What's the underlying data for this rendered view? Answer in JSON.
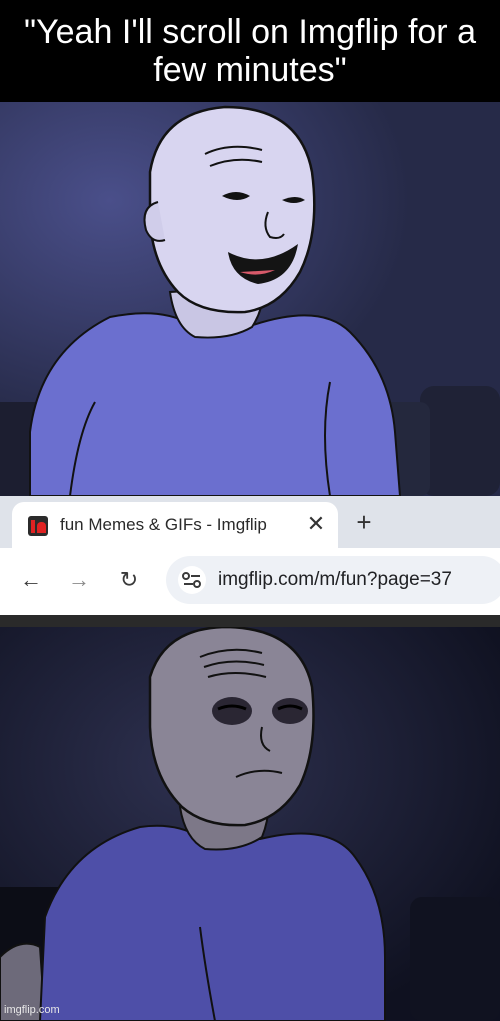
{
  "meme": {
    "caption": "\"Yeah I'll scroll on Imgflip for a few minutes\"",
    "watermark": "imgflip.com"
  },
  "browser": {
    "tab_title": "fun Memes & GIFs - Imgflip",
    "url": "imgflip.com/m/fun?page=37"
  },
  "icons": {
    "favicon": "imgflip-logo-icon",
    "tab_close": "close-icon",
    "new_tab": "plus-icon",
    "back": "arrow-left-icon",
    "forward": "arrow-right-icon",
    "reload": "reload-icon",
    "site_info": "tune-icon"
  },
  "colors": {
    "caption_background": "#000000",
    "caption_text": "#ffffff",
    "shirt": "#6b6fcf",
    "top_background": "#2d3152",
    "bottom_background": "#121522"
  }
}
